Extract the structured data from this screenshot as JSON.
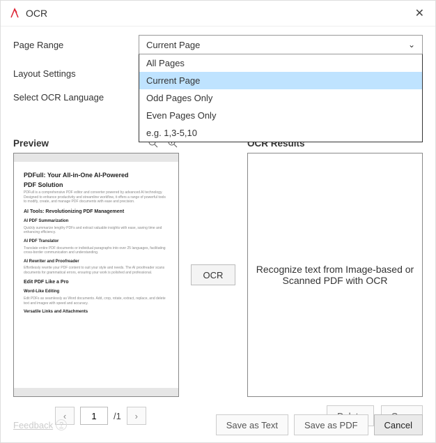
{
  "window": {
    "title": "OCR",
    "close": "✕"
  },
  "form": {
    "pageRange": {
      "label": "Page Range",
      "selected": "Current Page",
      "options": [
        "All Pages",
        "Current Page",
        "Odd Pages Only",
        "Even Pages Only",
        "e.g. 1,3-5,10"
      ]
    },
    "layoutSettings": {
      "label": "Layout Settings"
    },
    "ocrLanguage": {
      "label": "Select OCR Language"
    }
  },
  "preview": {
    "title": "Preview",
    "doc": {
      "h1a": "PDFull: Your All-in-One AI-Powered",
      "h1b": "PDF Solution",
      "p1": "PDFull is a comprehensive PDF editor and converter powered by advanced AI technology. Designed to enhance productivity and streamline workflow, it offers a range of powerful tools to modify, create, and manage PDF documents with ease and precision.",
      "h2a": "AI Tools: Revolutionizing PDF Management",
      "h3a": "AI PDF Summarization",
      "p2": "Quickly summarize lengthy PDFs and extract valuable insights with ease, saving time and enhancing efficiency.",
      "h3b": "AI PDF Translator",
      "p3": "Translate entire PDF documents or individual paragraphs into over 25 languages, facilitating cross-border communication and understanding.",
      "h3c": "AI Rewriter and Proofreader",
      "p4": "Effortlessly rewrite your PDF content to suit your style and needs. The AI proofreader scans documents for grammatical errors, ensuring your work is polished and professional.",
      "h2b": "Edit PDF Like a Pro",
      "h3d": "Word-Like Editing",
      "p5": "Edit PDFs as seamlessly as Word documents. Add, crop, rotate, extract, replace, and delete text and images with speed and accuracy.",
      "h3e": "Versatile Links and Attachments"
    }
  },
  "results": {
    "title": "OCR Results",
    "placeholder": "Recognize text from Image-based or Scanned PDF with OCR"
  },
  "ocrButton": "OCR",
  "pager": {
    "current": "1",
    "totalLabel": "/1",
    "prev": "‹",
    "next": "›"
  },
  "actions": {
    "delete": "Delete",
    "copy": "Copy",
    "saveText": "Save as Text",
    "savePdf": "Save as PDF",
    "cancel": "Cancel",
    "feedback": "Feedback"
  }
}
